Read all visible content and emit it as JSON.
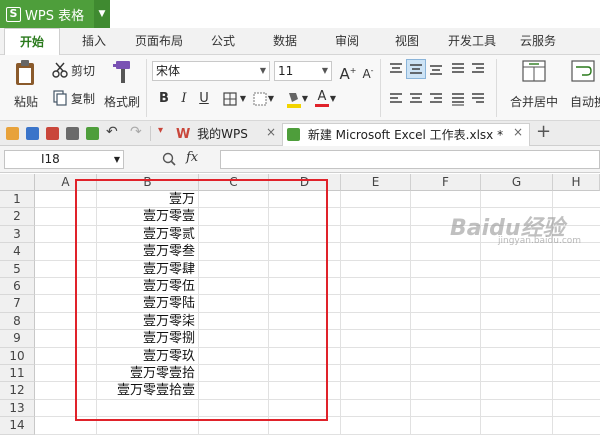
{
  "app": {
    "title": "WPS 表格",
    "logo_letter": "S"
  },
  "menu": {
    "tabs": [
      "开始",
      "插入",
      "页面布局",
      "公式",
      "数据",
      "审阅",
      "视图",
      "开发工具",
      "云服务"
    ]
  },
  "ribbon": {
    "paste": "粘贴",
    "cut": "剪切",
    "copy": "复制",
    "format_painter": "格式刷",
    "font_name": "宋体",
    "font_size": "11",
    "grow": "A",
    "shrink": "A",
    "bold": "B",
    "italic": "I",
    "underline": "U",
    "font_color": "A",
    "merge_center": "合并居中",
    "auto_wrap": "自动换"
  },
  "doc_tabs": {
    "my_wps": "我的WPS",
    "file_tab": "新建 Microsoft Excel 工作表.xlsx *",
    "new_tab": "+"
  },
  "formula_bar": {
    "cell_ref": "I18",
    "fx_label": "fx",
    "formula": ""
  },
  "sheet": {
    "columns": [
      "A",
      "B",
      "C",
      "D",
      "E",
      "F",
      "G",
      "H"
    ],
    "rows": [
      "1",
      "2",
      "3",
      "4",
      "5",
      "6",
      "7",
      "8",
      "9",
      "10",
      "11",
      "12",
      "13",
      "14"
    ],
    "column_b_values": [
      "壹万",
      "壹万零壹",
      "壹万零贰",
      "壹万零叁",
      "壹万零肆",
      "壹万零伍",
      "壹万零陆",
      "壹万零柒",
      "壹万零捌",
      "壹万零玖",
      "壹万零壹拾",
      "壹万零壹拾壹"
    ]
  },
  "watermark": {
    "main": "Baidu经验",
    "sub": "jingyan.baidu.com"
  },
  "colors": {
    "accent_green": "#4e9e3b",
    "highlight_red": "#e0222a"
  }
}
